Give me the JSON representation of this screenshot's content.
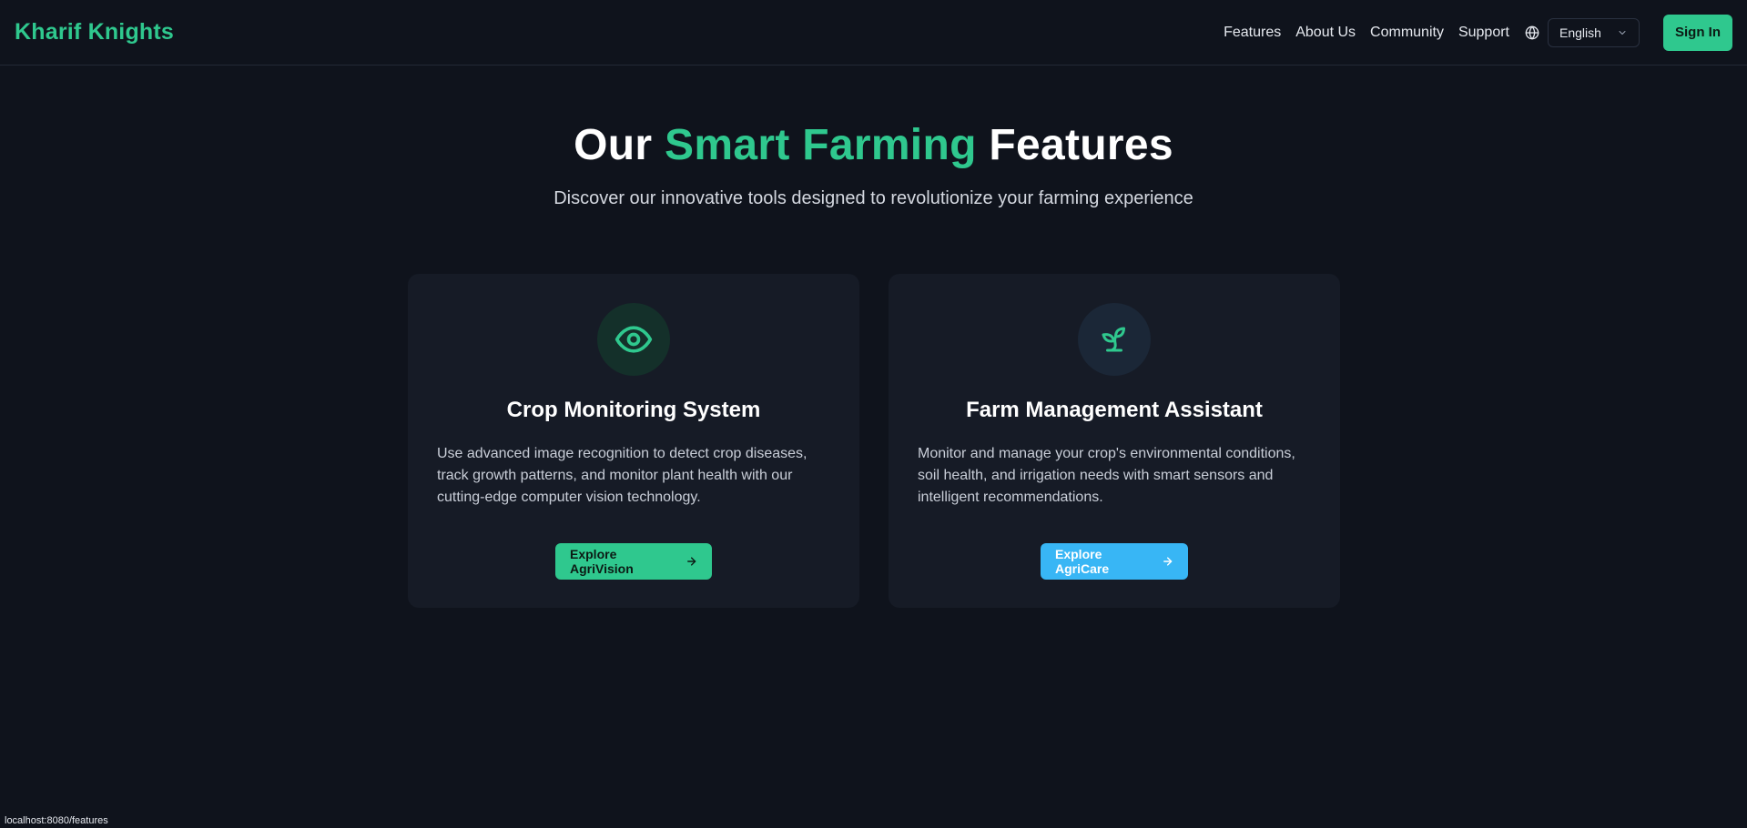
{
  "header": {
    "brand": "Kharif Knights",
    "nav": [
      "Features",
      "About Us",
      "Community",
      "Support"
    ],
    "language": "English",
    "signin_label": "Sign In"
  },
  "hero": {
    "title_prefix": "Our",
    "title_accent": "Smart Farming",
    "title_suffix": "Features",
    "subtitle": "Discover our innovative tools designed to revolutionize your farming experience"
  },
  "cards": [
    {
      "icon": "eye-icon",
      "title": "Crop Monitoring System",
      "description": "Use advanced image recognition to detect crop diseases, track growth patterns, and monitor plant health with our cutting-edge computer vision technology.",
      "button": "Explore AgriVision"
    },
    {
      "icon": "sprout-icon",
      "title": "Farm Management Assistant",
      "description": "Monitor and manage your crop's environmental conditions, soil health, and irrigation needs with smart sensors and intelligent recommendations.",
      "button": "Explore AgriCare"
    }
  ],
  "status_url": "localhost:8080/features",
  "colors": {
    "background": "#0f131c",
    "accent_green": "#2fc88e",
    "accent_blue": "#38b6f5",
    "card": "#161b26"
  }
}
